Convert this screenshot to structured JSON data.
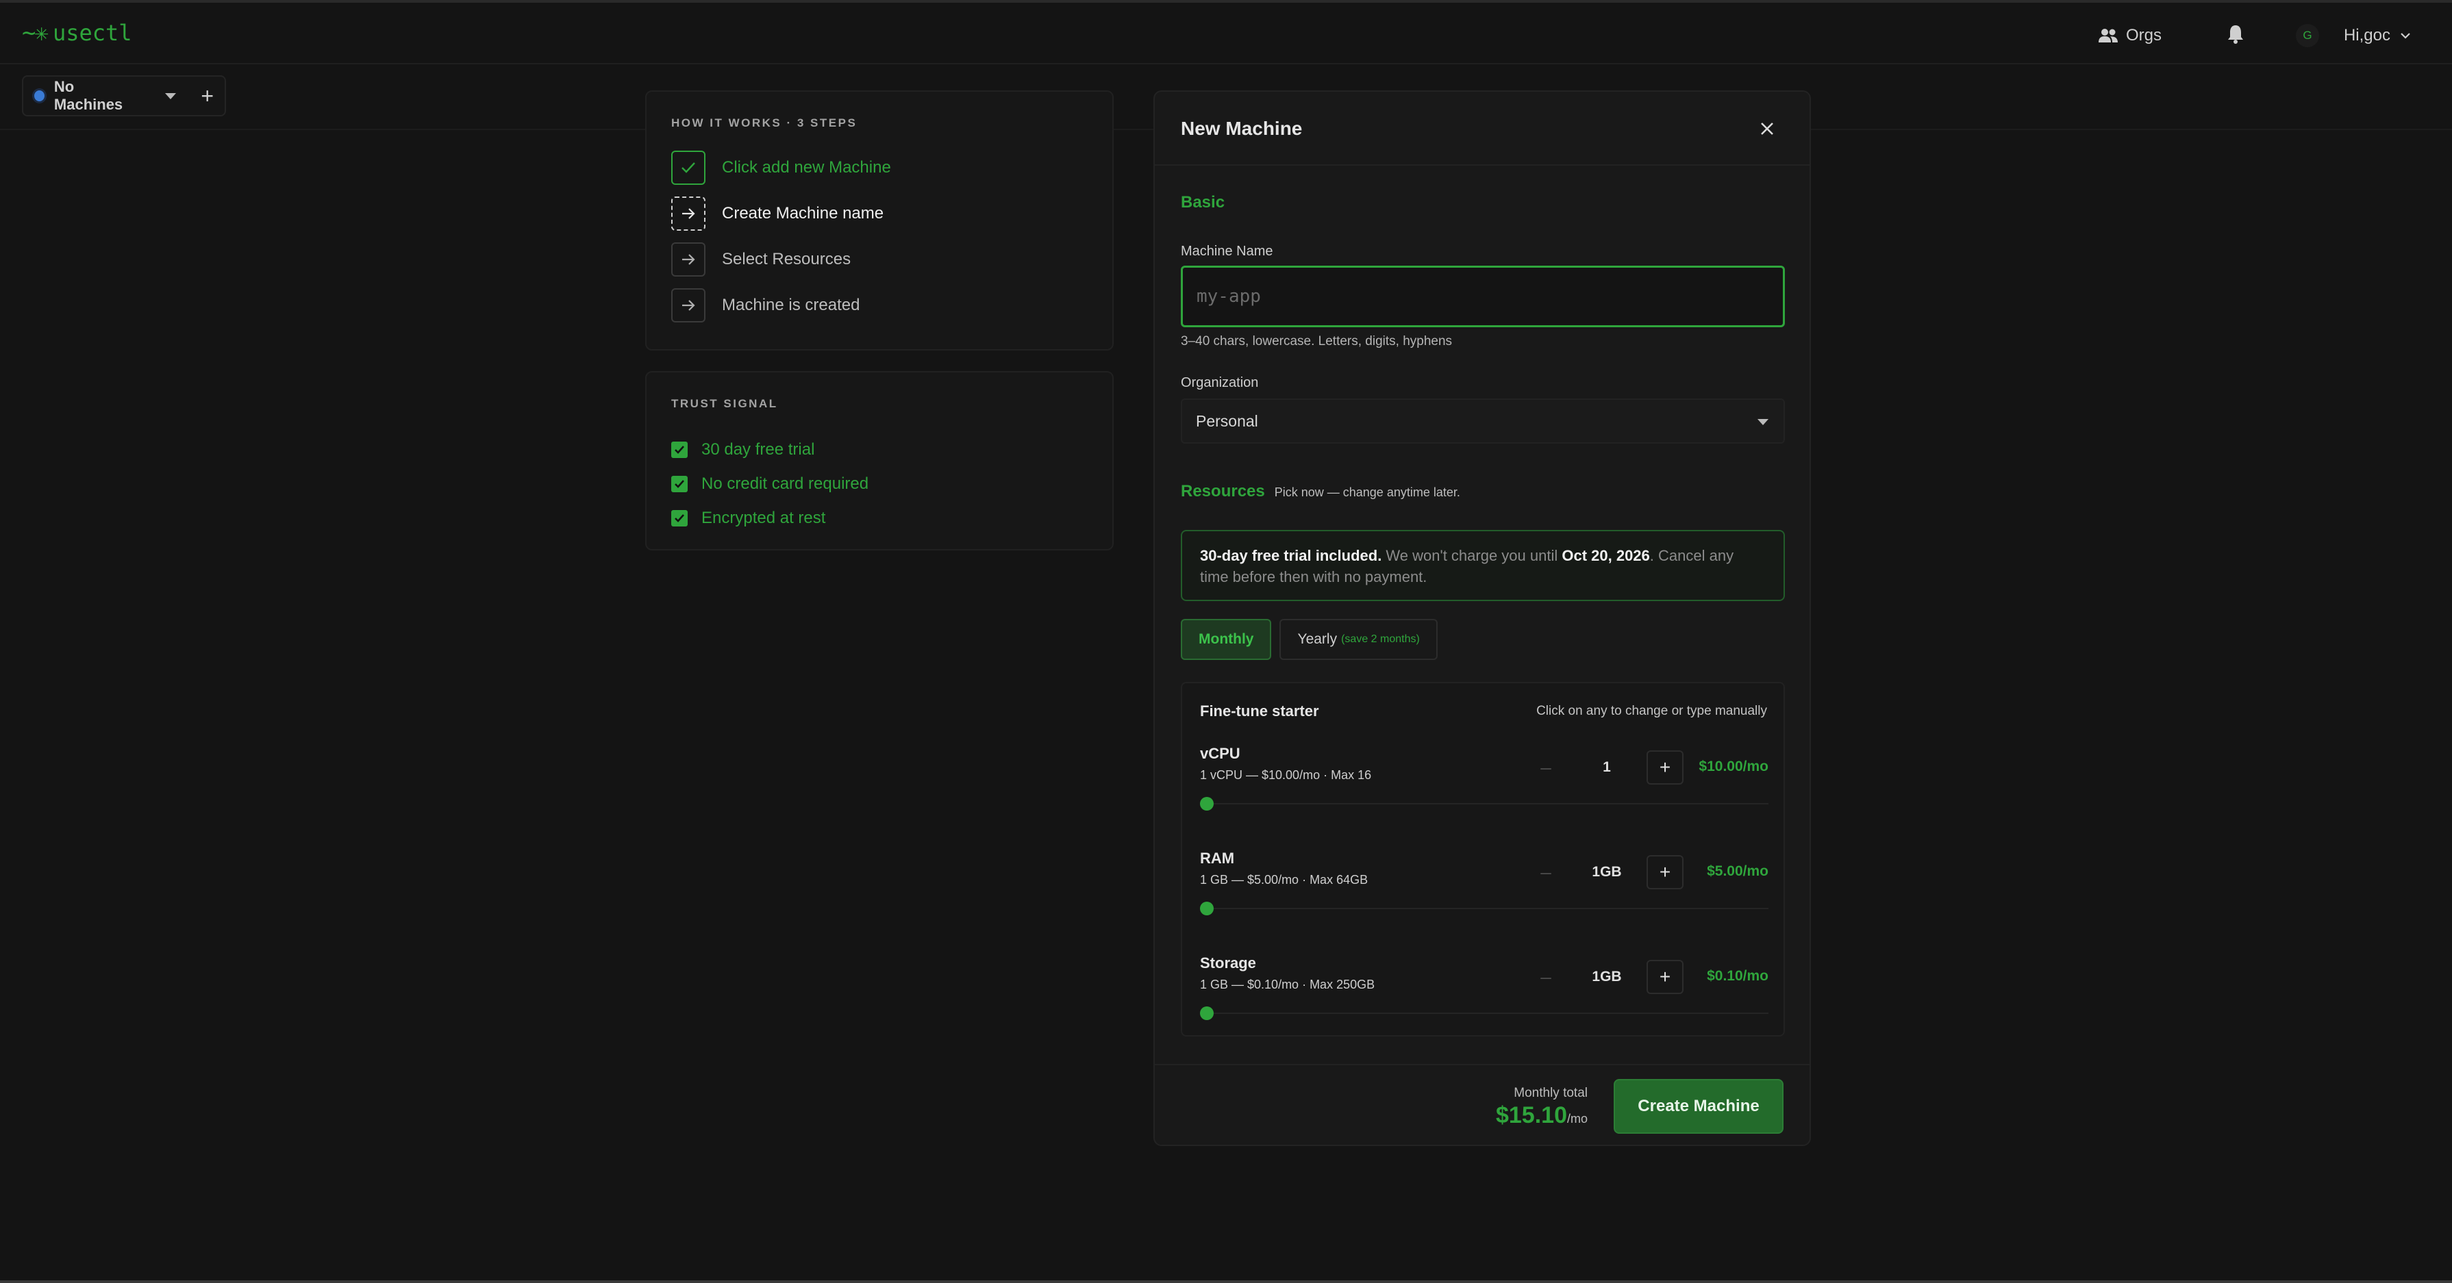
{
  "header": {
    "logo_mark": "~✳",
    "logo_text": "usectl",
    "orgs_label": "Orgs",
    "user_initial": "G",
    "user_greeting": "Hi,goc"
  },
  "subbar": {
    "machine_selector": "No Machines"
  },
  "how_it_works": {
    "title": "HOW IT WORKS · 3 STEPS",
    "steps": [
      {
        "label": "Click add new Machine",
        "state": "done"
      },
      {
        "label": "Create Machine name",
        "state": "active"
      },
      {
        "label": "Select Resources",
        "state": "pending"
      },
      {
        "label": "Machine is created",
        "state": "pending"
      }
    ]
  },
  "trust_signal": {
    "title": "TRUST SIGNAL",
    "items": [
      "30 day free trial",
      "No credit card required",
      "Encrypted at rest"
    ]
  },
  "modal": {
    "title": "New Machine",
    "basic_title": "Basic",
    "machine_name_label": "Machine Name",
    "machine_name_value": "",
    "machine_name_placeholder": "my-app",
    "machine_name_hint": "3–40 chars, lowercase. Letters, digits, hyphens",
    "organization_label": "Organization",
    "organization_value": "Personal",
    "resources_title": "Resources",
    "resources_subtitle": "Pick now — change anytime later.",
    "trial": {
      "bold1": "30-day free trial included.",
      "text1": " We won't charge you until ",
      "bold2": "Oct 20, 2026",
      "text2": ". Cancel any time before then with no payment."
    },
    "billing": {
      "monthly": "Monthly",
      "yearly": "Yearly",
      "yearly_tag": "(save 2 months)",
      "selected": "Monthly"
    },
    "plan": {
      "name": "Fine-tune starter",
      "hint": "Click on any to change or type manually",
      "resources": [
        {
          "name": "vCPU",
          "meta": "1 vCPU — $10.00/mo · Max 16",
          "minus": "–",
          "qty": "1",
          "plus": "+",
          "price": "$10.00/mo",
          "level": 0
        },
        {
          "name": "RAM",
          "meta": "1 GB — $5.00/mo · Max 64GB",
          "minus": "–",
          "qty": "1GB",
          "plus": "+",
          "price": "$5.00/mo",
          "level": 0
        },
        {
          "name": "Storage",
          "meta": "1 GB — $0.10/mo · Max 250GB",
          "minus": "–",
          "qty": "1GB",
          "plus": "+",
          "price": "$0.10/mo",
          "level": 0
        }
      ]
    },
    "footer": {
      "total_label": "Monthly total",
      "total_value": "$15.10",
      "total_unit": "/mo",
      "create_label": "Create Machine"
    }
  },
  "colors": {
    "accent": "#2fa53c",
    "background": "#141414",
    "panel": "#171717"
  },
  "icons": [
    "logo-icon",
    "people-icon",
    "bell-icon",
    "chevron-down-icon",
    "plus-icon",
    "check-icon",
    "arrow-right-icon",
    "close-icon"
  ]
}
